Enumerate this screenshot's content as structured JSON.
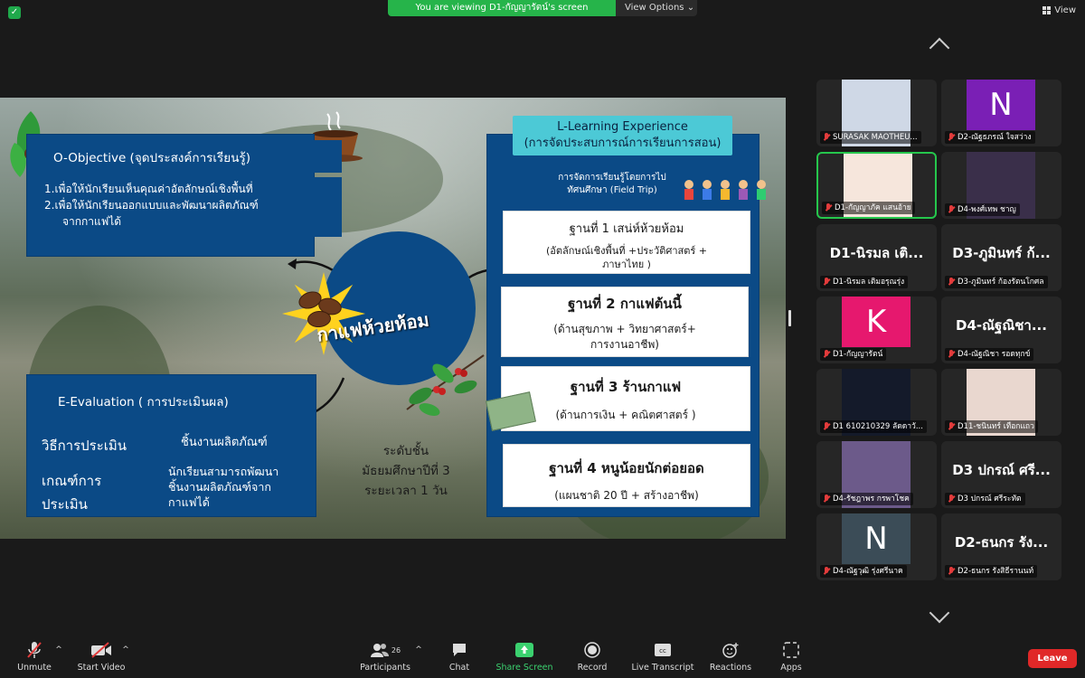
{
  "top_bar": {
    "sharing_banner": "You are viewing D1-กัญญารัตน์'s screen",
    "view_options_label": "View Options",
    "view_label": "View"
  },
  "slide": {
    "objective": {
      "title": "O-Objective (จุดประสงค์การเรียนรู้)",
      "line1": "1.เพื่อให้นักเรียนเห็นคุณค่าอัตลักษณ์เชิงพื้นที่",
      "line2": "2.เพื่อให้นักเรียนออกแบบและพัฒนาผลิตภัณฑ์",
      "line3": "จากกาแฟได้"
    },
    "center_title": "กาแฟห้วยห้อม",
    "evaluation": {
      "title": "E-Evaluation ( การประเมินผล)",
      "method_label": "วิธีการประเมิน",
      "method_value": "ชิ้นงานผลิตภัณฑ์",
      "criteria_label_1": "เกณฑ์การ",
      "criteria_label_2": "ประเมิน",
      "criteria_value_1": "นักเรียนสามารถพัฒนา",
      "criteria_value_2": "ชิ้นงานผลิตภัณฑ์จาก",
      "criteria_value_3": "กาแฟได้"
    },
    "level": {
      "line1": "ระดับชั้น",
      "line2": "มัธยมศึกษาปีที่ 3",
      "line3": "ระยะเวลา 1 วัน"
    },
    "learning": {
      "title_1": "L-Learning Experience",
      "title_2": "(การจัดประสบการณ์การเรียนการสอน)",
      "intro_1": "การจัดการเรียนรู้โดยการไป",
      "intro_2": "ทัศนศึกษา (Field Trip)",
      "station1_title": "ฐานที่ 1 เสน่ห์ห้วยห้อม",
      "station1_sub_1": "(อัตลักษณ์เชิงพื้นที่ +ประวัติศาสตร์ +",
      "station1_sub_2": "ภาษาไทย )",
      "station2_title": "ฐานที่ 2 กาแฟต้นนี้",
      "station2_sub_1": "(ด้านสุขภาพ + วิทยาศาสตร์+",
      "station2_sub_2": "การงานอาชีพ)",
      "station3_title": "ฐานที่ 3 ร้านกาแฟ",
      "station3_sub": "(ด้านการเงิน + คณิตศาสตร์ )",
      "station4_title": "ฐานที่ 4 หนูน้อยนักต่อยอด",
      "station4_sub": "(แผนชาติ 20 ปี + สร้างอาชีพ)"
    }
  },
  "participants": [
    {
      "name": "SURASAK MAOTHEU...",
      "type": "video",
      "color": "#cfd8e6"
    },
    {
      "name": "D2-ณัฐธภรณ์ ใจสว่าง",
      "type": "letter",
      "letter": "N",
      "color": "#7a1fb5"
    },
    {
      "name": "D1-กัญญาภัค แสนอ้าย",
      "type": "video",
      "color": "#f6e6dc",
      "active": true
    },
    {
      "name": "D4-พงศ์เทพ ชาญ",
      "type": "video",
      "color": "#3a2f4a"
    },
    {
      "name": "D1-นิรมล เติมอรุณรุ่ง",
      "type": "name",
      "big": "D1-นิรมล เติ..."
    },
    {
      "name": "D3-ภูมินทร์ ก้องรัตนโกศล",
      "type": "name",
      "big": "D3-ภูมินทร์ ก้..."
    },
    {
      "name": "D1-กัญญารัตน์",
      "type": "letter",
      "letter": "K",
      "color": "#e6186e"
    },
    {
      "name": "D4-ณัฐณิชา รอดทุกข์",
      "type": "name",
      "big": "D4-ณัฐณิชา..."
    },
    {
      "name": "D1 610210329 ลัดดาวั...",
      "type": "video",
      "color": "#141a2a"
    },
    {
      "name": "D11-ชนินทร์ เทือกแถว",
      "type": "video",
      "color": "#e9d7cf"
    },
    {
      "name": "D4-รัชฎาพร กรพาโชค",
      "type": "video",
      "color": "#6c5a8a"
    },
    {
      "name": "D3 ปกรณ์ ศรีระทัต",
      "type": "name",
      "big": "D3 ปกรณ์ ศรี..."
    },
    {
      "name": "D4-ณัฐวุฒิ รุ่งศรีนาค",
      "type": "letter",
      "letter": "N",
      "color": "#3b4c57"
    },
    {
      "name": "D2-ธนกร รังสิธีรานนท์",
      "type": "name",
      "big": "D2-ธนกร รัง..."
    }
  ],
  "toolbar": {
    "unmute": "Unmute",
    "start_video": "Start Video",
    "participants": "Participants",
    "participants_count": "26",
    "chat": "Chat",
    "share_screen": "Share Screen",
    "record": "Record",
    "live_transcript": "Live Transcript",
    "reactions": "Reactions",
    "apps": "Apps",
    "leave": "Leave"
  }
}
